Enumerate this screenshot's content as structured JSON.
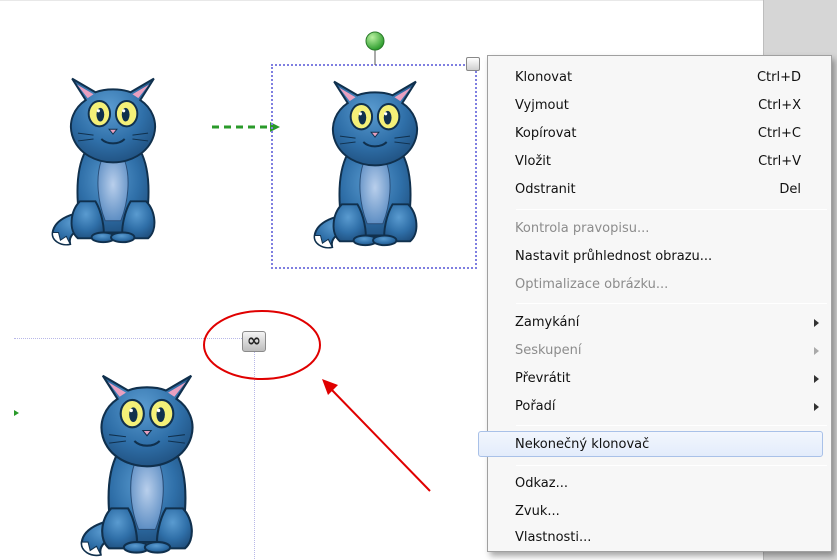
{
  "context_menu": {
    "items": [
      {
        "label": "Klonovat",
        "shortcut": "Ctrl+D"
      },
      {
        "label": "Vyjmout",
        "shortcut": "Ctrl+X"
      },
      {
        "label": "Kopírovat",
        "shortcut": "Ctrl+C"
      },
      {
        "label": "Vložit",
        "shortcut": "Ctrl+V"
      },
      {
        "label": "Odstranit",
        "shortcut": "Del"
      },
      {
        "label": "Kontrola pravopisu...",
        "disabled": true
      },
      {
        "label": "Nastavit průhlednost obrazu..."
      },
      {
        "label": "Optimalizace obrázku...",
        "disabled": true
      },
      {
        "label": "Zamykání",
        "submenu": true
      },
      {
        "label": "Seskupení",
        "submenu": true,
        "disabled": true
      },
      {
        "label": "Převrátit",
        "submenu": true
      },
      {
        "label": "Pořadí",
        "submenu": true
      },
      {
        "label": "Nekonečný klonovač",
        "highlighted": true
      },
      {
        "label": "Odkaz..."
      },
      {
        "label": "Zvuk..."
      },
      {
        "label": "Vlastnosti..."
      }
    ]
  },
  "colors": {
    "accent_annotation": "#e00000",
    "selection": "#7f7fe0",
    "rotate_handle": "#3fbf3f",
    "drag_arrow": "#2a9a2a",
    "cat_body": "#2f6fa8"
  },
  "icons": {
    "infinite_cloner": "infinity-icon",
    "rotate": "rotate-handle-icon",
    "menu": "object-menu-icon"
  }
}
